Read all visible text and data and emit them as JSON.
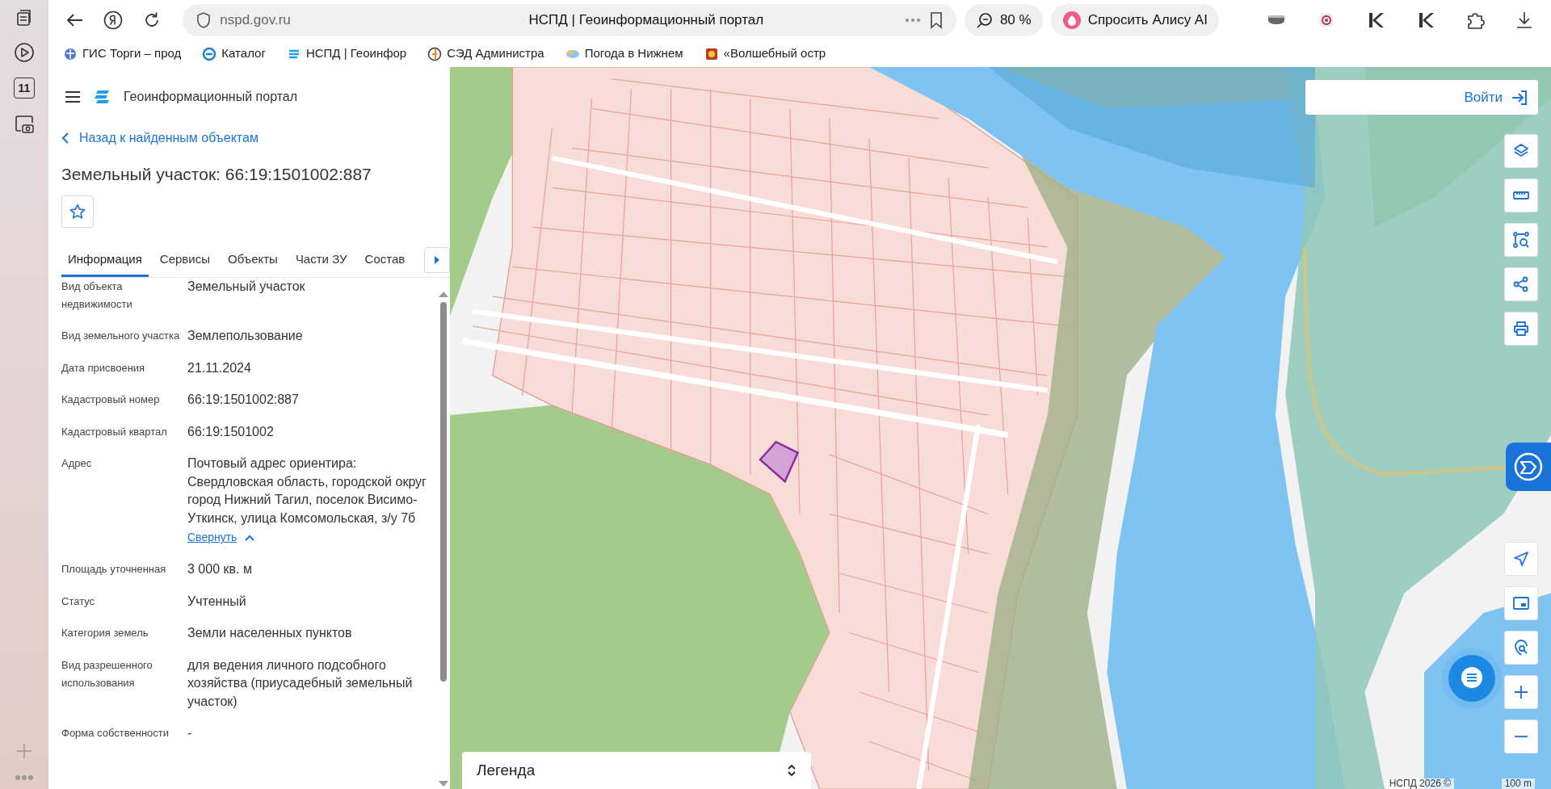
{
  "browser": {
    "sidebar_badge": "11",
    "address": "nspd.gov.ru",
    "page_title": "НСПД | Геоинформационный портал",
    "zoom": "80 %",
    "assistant": "Спросить Алису AI",
    "bookmarks": [
      {
        "label": "ГИС Торги – прод"
      },
      {
        "label": "Каталог"
      },
      {
        "label": "НСПД | Геоинфор"
      },
      {
        "label": "СЭД Администра"
      },
      {
        "label": "Погода в Нижнем"
      },
      {
        "label": "«Волшебный остр"
      }
    ]
  },
  "portal": {
    "title": "Геоинформационный портал",
    "back_link": "Назад к найденным объектам",
    "heading": "Земельный участок: 66:19:1501002:887",
    "favorite": false,
    "tabs": [
      {
        "label": "Информация",
        "selected": true
      },
      {
        "label": "Сервисы",
        "selected": false
      },
      {
        "label": "Объекты",
        "selected": false
      },
      {
        "label": "Части ЗУ",
        "selected": false
      },
      {
        "label": "Состав",
        "selected": false
      }
    ],
    "properties": [
      {
        "label": "Вид объекта недвижимости",
        "value": "Земельный участок"
      },
      {
        "label": "Вид земельного участка",
        "value": "Землепользование"
      },
      {
        "label": "Дата присвоения",
        "value": "21.11.2024"
      },
      {
        "label": "Кадастровый номер",
        "value": "66:19:1501002:887"
      },
      {
        "label": "Кадастровый квартал",
        "value": "66:19:1501002"
      },
      {
        "label": "Адрес",
        "value": "Почтовый адрес ориентира: Свердловская область, городской округ город Нижний Тагил, поселок Висимо-Уткинск, улица Комсомольская, з/у 7б",
        "expanded": true,
        "toggle_label": "Свернуть"
      },
      {
        "label": "Площадь уточненная",
        "value": "3 000 кв. м"
      },
      {
        "label": "Статус",
        "value": "Учтенный"
      },
      {
        "label": "Категория земель",
        "value": "Земли населенных пунктов"
      },
      {
        "label": "Вид разрешенного использования",
        "value": "для ведения личного подсобного хозяйства (приусадебный земельный участок)"
      },
      {
        "label": "Форма собственности",
        "value": "-"
      }
    ]
  },
  "map": {
    "login": "Войти",
    "legend": "Легенда",
    "attribution": "НСПД 2026 ©",
    "scale": "100 m"
  }
}
